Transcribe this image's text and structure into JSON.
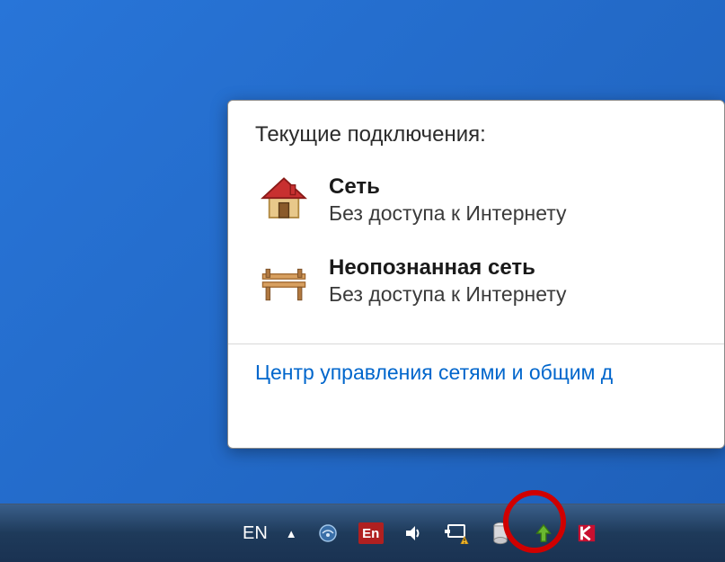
{
  "popup": {
    "title": "Текущие подключения:",
    "items": [
      {
        "icon": "home",
        "name": "Сеть",
        "status": "Без доступа к Интернету"
      },
      {
        "icon": "bench",
        "name": "Неопознанная сеть",
        "status": "Без доступа к Интернету"
      }
    ],
    "link": "Центр управления сетями и общим д"
  },
  "taskbar": {
    "lang_text": "EN",
    "lang_badge": "En"
  }
}
